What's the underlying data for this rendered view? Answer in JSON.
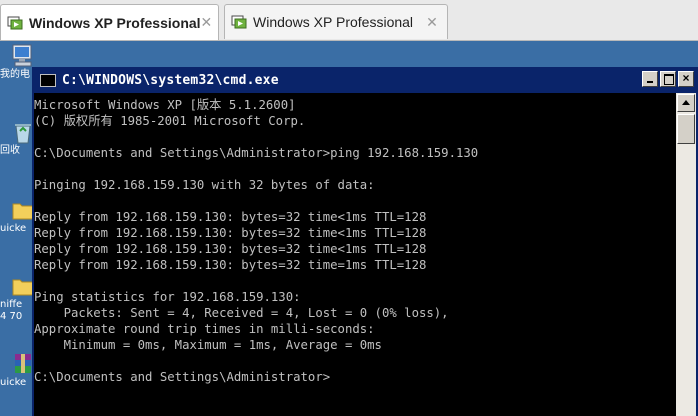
{
  "tabs": [
    {
      "label": "Windows XP Professional",
      "active": true
    },
    {
      "label": "Windows XP Professional",
      "active": false
    }
  ],
  "desktop_icons": [
    {
      "name": "my-computer-icon",
      "caption": "我的电"
    },
    {
      "name": "recycle-bin-icon",
      "caption": "回收"
    },
    {
      "name": "folder-icon",
      "caption": "uicke"
    },
    {
      "name": "folder-icon",
      "caption": "niffe 4 70"
    },
    {
      "name": "archive-icon",
      "caption": "uicke"
    }
  ],
  "cmd_window": {
    "title": "C:\\WINDOWS\\system32\\cmd.exe",
    "lines": [
      "Microsoft Windows XP [版本 5.1.2600]",
      "(C) 版权所有 1985-2001 Microsoft Corp.",
      "",
      "C:\\Documents and Settings\\Administrator>ping 192.168.159.130",
      "",
      "Pinging 192.168.159.130 with 32 bytes of data:",
      "",
      "Reply from 192.168.159.130: bytes=32 time<1ms TTL=128",
      "Reply from 192.168.159.130: bytes=32 time<1ms TTL=128",
      "Reply from 192.168.159.130: bytes=32 time<1ms TTL=128",
      "Reply from 192.168.159.130: bytes=32 time=1ms TTL=128",
      "",
      "Ping statistics for 192.168.159.130:",
      "    Packets: Sent = 4, Received = 4, Lost = 0 (0% loss),",
      "Approximate round trip times in milli-seconds:",
      "    Minimum = 0ms, Maximum = 1ms, Average = 0ms",
      "",
      "C:\\Documents and Settings\\Administrator>"
    ]
  },
  "colors": {
    "desktop_bg": "#3a6ea5",
    "console_bg": "#000000",
    "console_text": "#c0c0c0",
    "titlebar": "#0a246a"
  }
}
